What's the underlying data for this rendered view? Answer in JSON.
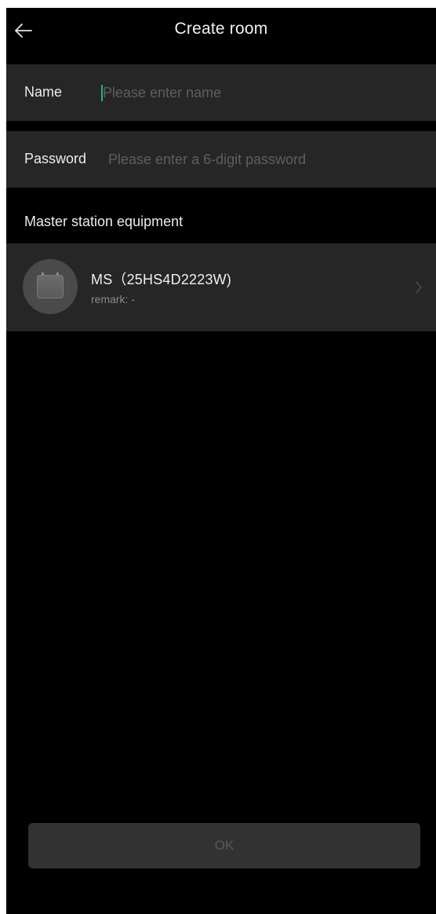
{
  "header": {
    "title": "Create room",
    "back_icon": "arrow-left-icon"
  },
  "form": {
    "name": {
      "label": "Name",
      "placeholder": "Please enter name",
      "value": ""
    },
    "password": {
      "label": "Password",
      "placeholder": "Please enter a 6-digit password",
      "value": ""
    }
  },
  "master_station": {
    "section_title": "Master station equipment",
    "device": {
      "name": "MS（25HS4D2223W)",
      "remark": "remark:  -",
      "icon": "master-station-device-icon",
      "chevron_icon": "chevron-right-icon"
    }
  },
  "footer": {
    "ok_label": "OK"
  },
  "colors": {
    "background": "#000000",
    "row_background": "#262626",
    "caret_accent": "#1fb38a",
    "button_background": "#323232",
    "button_text_disabled": "#5a5a5a"
  }
}
